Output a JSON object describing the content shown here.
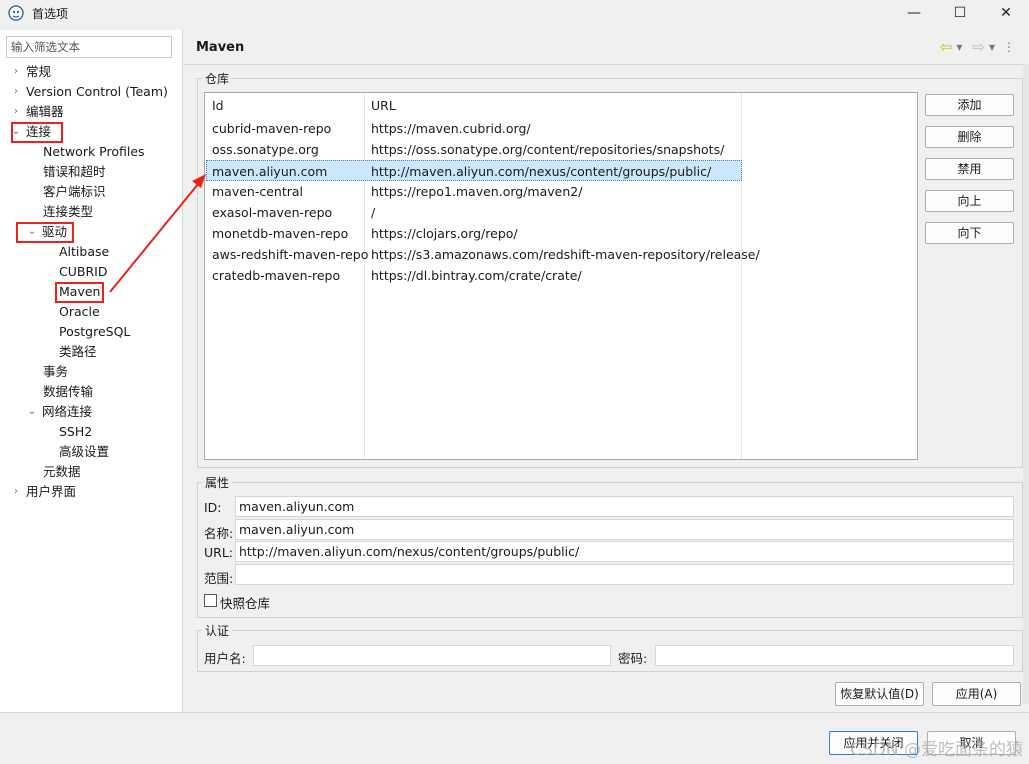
{
  "window": {
    "title": "首选项",
    "controls": {
      "minimize": "—",
      "maximize": "☐",
      "close": "✕"
    }
  },
  "filter": {
    "placeholder": "输入筛选文本"
  },
  "tree": [
    {
      "label": "常规",
      "expand": "›",
      "arrow": "chevron-right"
    },
    {
      "label": "Version Control (Team)",
      "expand": "›",
      "arrow": "chevron-right"
    },
    {
      "label": "编辑器",
      "expand": "›",
      "arrow": "chevron-right"
    },
    {
      "label": "连接",
      "expand": "⌄",
      "arrow": "chevron-down",
      "highlighted": true
    },
    {
      "label": "Network Profiles",
      "expand": ""
    },
    {
      "label": "错误和超时",
      "expand": ""
    },
    {
      "label": "客户端标识",
      "expand": ""
    },
    {
      "label": "连接类型",
      "expand": ""
    },
    {
      "label": "驱动",
      "expand": "⌄",
      "arrow": "chevron-down",
      "highlighted": true
    },
    {
      "label": "Altibase",
      "expand": ""
    },
    {
      "label": "CUBRID",
      "expand": ""
    },
    {
      "label": "Maven",
      "expand": "",
      "highlighted": true,
      "selected": true
    },
    {
      "label": "Oracle",
      "expand": ""
    },
    {
      "label": "PostgreSQL",
      "expand": ""
    },
    {
      "label": "类路径",
      "expand": ""
    },
    {
      "label": "事务",
      "expand": ""
    },
    {
      "label": "数据传输",
      "expand": ""
    },
    {
      "label": "网络连接",
      "expand": "⌄",
      "arrow": "chevron-down"
    },
    {
      "label": "SSH2",
      "expand": ""
    },
    {
      "label": "高级设置",
      "expand": ""
    },
    {
      "label": "元数据",
      "expand": ""
    },
    {
      "label": "用户界面",
      "expand": "›",
      "arrow": "chevron-right"
    }
  ],
  "panel": {
    "title": "Maven",
    "nav": {
      "back": "⇦",
      "back_menu": "▾",
      "forward": "⇨",
      "forward_menu": "▾",
      "more": "⋮"
    }
  },
  "repositories": {
    "group_label": "仓库",
    "columns": [
      "Id",
      "URL"
    ],
    "rows": [
      {
        "id": "cubrid-maven-repo",
        "url": "https://maven.cubrid.org/"
      },
      {
        "id": "oss.sonatype.org",
        "url": "https://oss.sonatype.org/content/repositories/snapshots/"
      },
      {
        "id": "maven.aliyun.com",
        "url": "http://maven.aliyun.com/nexus/content/groups/public/",
        "selected": true
      },
      {
        "id": "maven-central",
        "url": "https://repo1.maven.org/maven2/"
      },
      {
        "id": "exasol-maven-repo",
        "url": "/"
      },
      {
        "id": "monetdb-maven-repo",
        "url": "https://clojars.org/repo/"
      },
      {
        "id": "aws-redshift-maven-repo",
        "url": "https://s3.amazonaws.com/redshift-maven-repository/release/"
      },
      {
        "id": "cratedb-maven-repo",
        "url": "https://dl.bintray.com/crate/crate/"
      }
    ],
    "buttons": [
      "添加",
      "删除",
      "禁用",
      "向上",
      "向下"
    ]
  },
  "properties": {
    "group_label": "属性",
    "id_label": "ID:",
    "id_value": "maven.aliyun.com",
    "name_label": "名称:",
    "name_value": "maven.aliyun.com",
    "url_label": "URL:",
    "url_value": "http://maven.aliyun.com/nexus/content/groups/public/",
    "scope_label": "范围:",
    "scope_value": "",
    "snapshot_label": "快照仓库",
    "snapshot_checked": false
  },
  "auth": {
    "group_label": "认证",
    "user_label": "用户名:",
    "user_value": "",
    "password_label": "密码:",
    "password_value": ""
  },
  "actions": {
    "restore_defaults": "恢复默认值(D)",
    "apply": "应用(A)"
  },
  "footer": {
    "apply_close": "应用并关闭",
    "cancel": "取消",
    "watermark": "CSDN @爱吃面条的猿"
  },
  "colors": {
    "highlight_red": "#e8241c",
    "selection_blue": "#cce8ff",
    "primary_border": "#2a7fd4"
  }
}
